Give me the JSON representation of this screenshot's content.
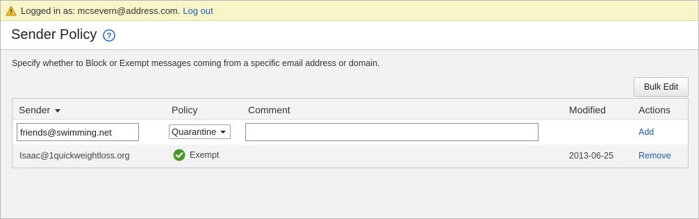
{
  "login_bar": {
    "text": "Logged in as: mcsevern@address.com.",
    "logout_label": "Log out",
    "icon": "warning-icon"
  },
  "header": {
    "title": "Sender Policy",
    "help_icon": "help-icon"
  },
  "description": "Specify whether to Block or Exempt messages coming from a specific email address or domain.",
  "toolbar": {
    "bulk_edit_label": "Bulk Edit"
  },
  "table": {
    "columns": [
      "Sender",
      "Policy",
      "Comment",
      "Modified",
      "Actions"
    ],
    "sort_column": "Sender",
    "new_entry": {
      "sender_value": "friends@swimming.net",
      "policy_value": "Quarantine",
      "comment_value": "",
      "action_label": "Add"
    },
    "rows": [
      {
        "sender": "Isaac@1quickweightloss.org",
        "policy": "Exempt",
        "policy_icon": "check-circle-icon",
        "comment": "",
        "modified": "2013-06-25",
        "action_label": "Remove"
      }
    ]
  },
  "colors": {
    "login_bar_bg": "#f8f6c8",
    "link": "#1a5fb4",
    "exempt_green": "#4a9a2a",
    "help_blue": "#2c6fc2"
  }
}
